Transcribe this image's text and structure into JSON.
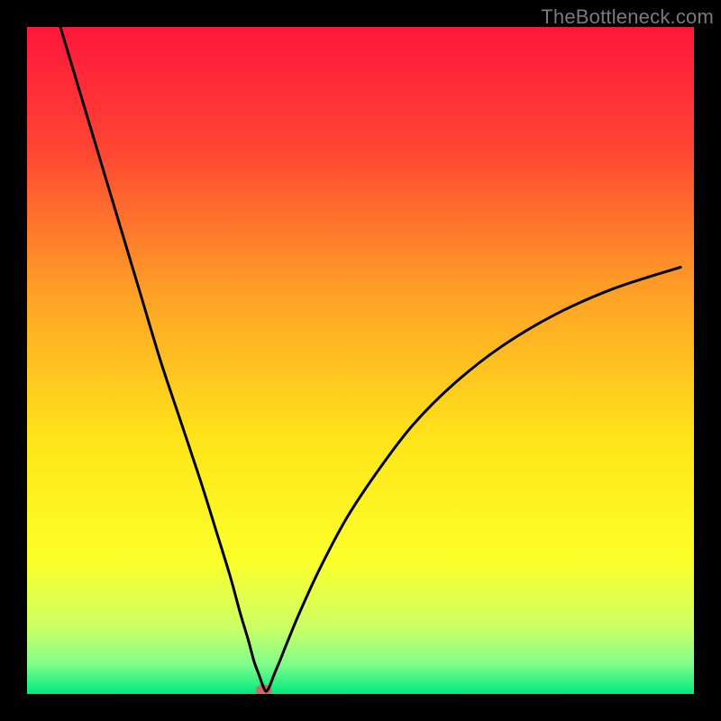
{
  "watermark": "TheBottleneck.com",
  "chart_data": {
    "type": "line",
    "title": "",
    "xlabel": "",
    "ylabel": "",
    "xlim": [
      0,
      100
    ],
    "ylim": [
      0,
      100
    ],
    "grid": false,
    "background_gradient": {
      "stops": [
        {
          "offset": 0.0,
          "color": "#ff173b"
        },
        {
          "offset": 0.18,
          "color": "#ff4433"
        },
        {
          "offset": 0.4,
          "color": "#ffa126"
        },
        {
          "offset": 0.62,
          "color": "#ffe51a"
        },
        {
          "offset": 0.8,
          "color": "#fbff2a"
        },
        {
          "offset": 0.9,
          "color": "#ccff66"
        },
        {
          "offset": 0.955,
          "color": "#7fff8a"
        },
        {
          "offset": 1.0,
          "color": "#00e97e"
        }
      ]
    },
    "series": [
      {
        "name": "bottleneck-curve",
        "x": [
          5,
          8,
          11,
          14,
          17,
          20,
          23,
          26,
          28.5,
          30.5,
          32,
          33.2,
          34,
          34.8,
          35.3,
          35.8,
          36.3,
          37,
          38,
          39.2,
          41,
          44,
          48,
          53,
          58,
          64,
          71,
          79,
          88,
          98
        ],
        "y": [
          100,
          90,
          80,
          70,
          60,
          50,
          41,
          32,
          24,
          17.5,
          12,
          8,
          5,
          2.8,
          1.4,
          0.4,
          1.0,
          2.8,
          5.2,
          8.2,
          12.5,
          19,
          26.5,
          34,
          40.5,
          46.5,
          52,
          56.8,
          60.8,
          64
        ],
        "color": "#000000",
        "stroke_width": 3
      }
    ],
    "marker": {
      "name": "minimum-point",
      "x": 35.5,
      "y": 0.6,
      "rx": 9,
      "ry": 6,
      "color": "#cf6a6a"
    }
  }
}
